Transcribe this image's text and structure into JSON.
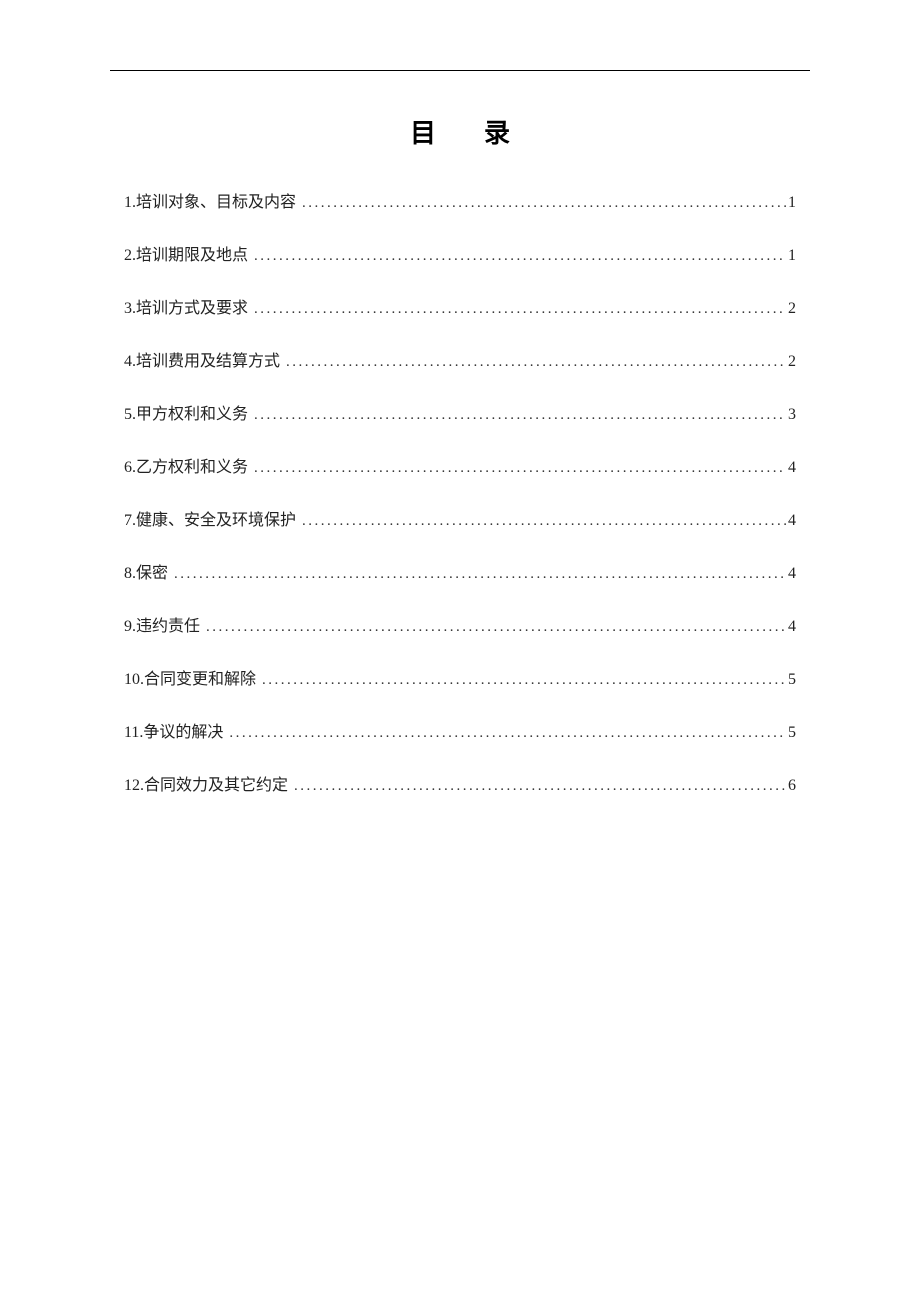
{
  "title": "目录",
  "toc": [
    {
      "num": "1.",
      "label": "培训对象、目标及内容",
      "page": "1"
    },
    {
      "num": "2.",
      "label": "培训期限及地点",
      "page": "1"
    },
    {
      "num": "3.",
      "label": "培训方式及要求",
      "page": "2"
    },
    {
      "num": "4.",
      "label": "培训费用及结算方式",
      "page": "2"
    },
    {
      "num": "5.",
      "label": "甲方权利和义务",
      "page": "3"
    },
    {
      "num": "6.",
      "label": "乙方权利和义务",
      "page": "4"
    },
    {
      "num": "7.",
      "label": " 健康、安全及环境保护",
      "page": "4"
    },
    {
      "num": "8.",
      "label": "保密",
      "page": "4"
    },
    {
      "num": "9.",
      "label": "违约责任",
      "page": "4"
    },
    {
      "num": "10.",
      "label": "合同变更和解除",
      "page": "5"
    },
    {
      "num": "11.",
      "label": "争议的解决",
      "page": "5"
    },
    {
      "num": "12.",
      "label": " 合同效力及其它约定",
      "page": "6"
    }
  ]
}
